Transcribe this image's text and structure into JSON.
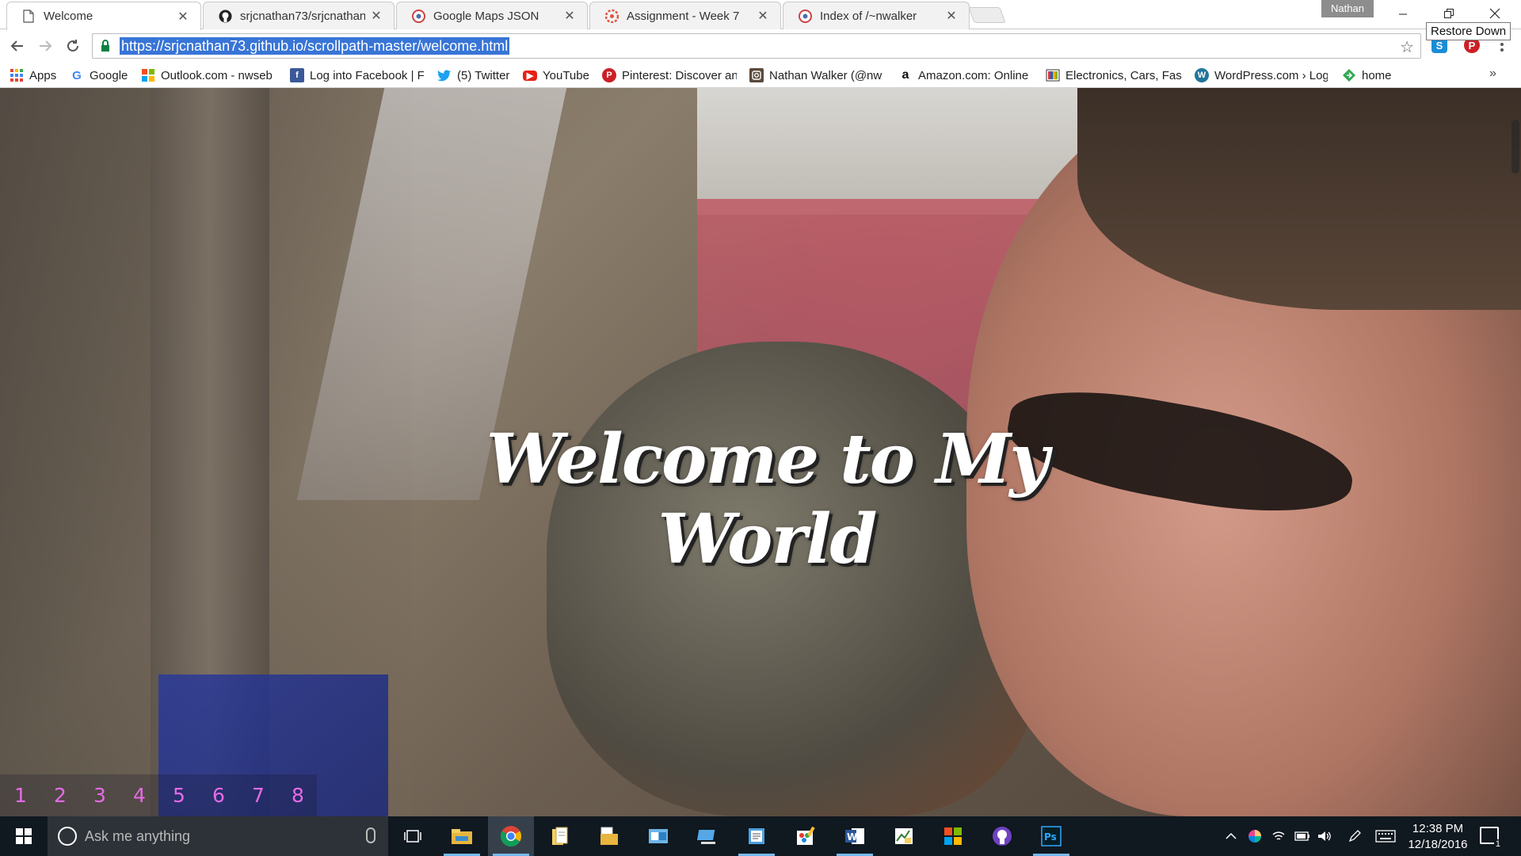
{
  "browser": {
    "tabs": [
      {
        "title": "Welcome",
        "icon": "page-icon",
        "active": true
      },
      {
        "title": "srjcnathan73/srjcnathan7",
        "icon": "github-icon",
        "active": false
      },
      {
        "title": "Google Maps JSON",
        "icon": "jsfiddle-icon",
        "active": false
      },
      {
        "title": "Assignment - Week 7",
        "icon": "canvas-icon",
        "active": false
      },
      {
        "title": "Index of /~nwalker",
        "icon": "jsfiddle-icon",
        "active": false
      }
    ],
    "profile_name": "Nathan",
    "tooltip": "Restore Down",
    "url": "https://srjcnathan73.github.io/scrollpath-master/welcome.html",
    "bookmarks": [
      {
        "label": "Apps",
        "icon": "apps-grid-icon"
      },
      {
        "label": "Google",
        "icon": "google-icon"
      },
      {
        "label": "Outlook.com - nwseb",
        "icon": "outlook-icon"
      },
      {
        "label": "Log into Facebook | F",
        "icon": "facebook-icon"
      },
      {
        "label": "(5) Twitter",
        "icon": "twitter-icon"
      },
      {
        "label": "YouTube",
        "icon": "youtube-icon"
      },
      {
        "label": "Pinterest: Discover an",
        "icon": "pinterest-icon"
      },
      {
        "label": "Nathan Walker (@nw",
        "icon": "instagram-icon"
      },
      {
        "label": "Amazon.com: Online",
        "icon": "amazon-icon"
      },
      {
        "label": "Electronics, Cars, Fash",
        "icon": "ebay-icon"
      },
      {
        "label": "WordPress.com › Log",
        "icon": "wordpress-icon"
      },
      {
        "label": "home",
        "icon": "home-diamond-icon"
      }
    ],
    "bookmarks_overflow": "»"
  },
  "page": {
    "headline": "Welcome to My World",
    "pager": [
      "1",
      "2",
      "3",
      "4",
      "5",
      "6",
      "7",
      "8"
    ]
  },
  "taskbar": {
    "search_placeholder": "Ask me anything",
    "time": "12:38 PM",
    "date": "12/18/2016",
    "notification_count": "1",
    "apps": [
      "file-explorer-icon",
      "chrome-icon",
      "documents-icon",
      "folder-icon",
      "outlook-icon",
      "remote-desktop-icon",
      "notepad-icon",
      "paint-icon",
      "word-icon",
      "excel-icon",
      "store-icon",
      "github-icon",
      "photoshop-icon"
    ]
  },
  "colors": {
    "url_highlight": "#3875d7",
    "pager_link": "#e66be6",
    "taskbar": "#101820"
  }
}
